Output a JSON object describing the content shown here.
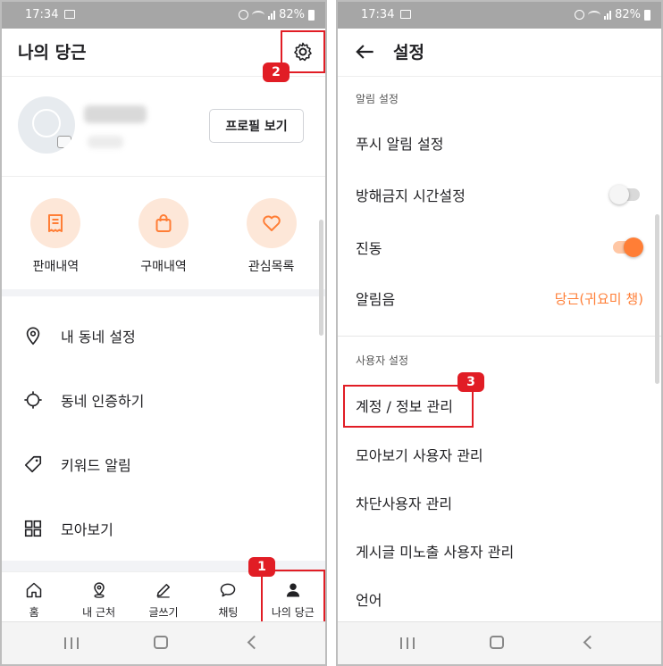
{
  "status": {
    "time": "17:34",
    "battery": "82%"
  },
  "left": {
    "title": "나의 당근",
    "profile_button": "프로필 보기",
    "quick": [
      {
        "label": "판매내역",
        "icon": "receipt-icon"
      },
      {
        "label": "구매내역",
        "icon": "shopping-bag-icon"
      },
      {
        "label": "관심목록",
        "icon": "heart-icon"
      }
    ],
    "menu": [
      {
        "label": "내 동네 설정",
        "icon": "location-pin-icon"
      },
      {
        "label": "동네 인증하기",
        "icon": "crosshair-icon"
      },
      {
        "label": "키워드 알림",
        "icon": "tag-icon"
      },
      {
        "label": "모아보기",
        "icon": "grid-icon"
      }
    ],
    "tabs": [
      {
        "label": "홈",
        "icon": "home-icon"
      },
      {
        "label": "내 근처",
        "icon": "nearby-pin-icon"
      },
      {
        "label": "글쓰기",
        "icon": "pencil-icon"
      },
      {
        "label": "채팅",
        "icon": "chat-icon"
      },
      {
        "label": "나의 당근",
        "icon": "person-icon"
      }
    ],
    "badges": {
      "settings": "2",
      "my_tab": "1"
    }
  },
  "right": {
    "title": "설정",
    "notif_section": "알림 설정",
    "push_label": "푸시 알림 설정",
    "dnd_label": "방해금지 시간설정",
    "vibrate_label": "진동",
    "sound_label": "알림음",
    "sound_value": "당근(귀요미 챙)",
    "dnd_on": false,
    "vibrate_on": true,
    "user_section": "사용자 설정",
    "account_label": "계정 / 정보 관리",
    "account_badge": "3",
    "feed_users_label": "모아보기 사용자 관리",
    "blocked_label": "차단사용자 관리",
    "hidden_posts_label": "게시글 미노출 사용자 관리",
    "language_label": "언어"
  },
  "colors": {
    "accent": "#ff7e36",
    "highlight": "#e11d25",
    "soft_orange": "#fde7d8"
  }
}
